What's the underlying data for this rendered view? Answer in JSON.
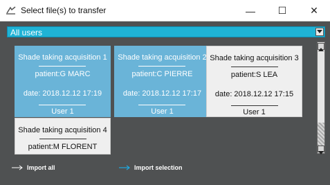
{
  "window": {
    "title": "Select file(s) to transfer",
    "controls": {
      "minimize": "—",
      "maximize": "☐",
      "close": "✕"
    }
  },
  "user_filter": {
    "selected": "All users"
  },
  "acquisitions": [
    {
      "title": "Shade taking acquisition 1",
      "patient": "patient:G MARC",
      "date": "date: 2018.12.12 17:19",
      "user": "User 1",
      "selected": true
    },
    {
      "title": "Shade taking acquisition 2",
      "patient": "patient:C PIERRE",
      "date": "date: 2018.12.12 17:17",
      "user": "User 1",
      "selected": true
    },
    {
      "title": "Shade taking acquisition 3",
      "patient": "patient:S LEA",
      "date": "date: 2018.12.12 17:15",
      "user": "User 1",
      "selected": false
    },
    {
      "title": "Shade taking acquisition 4",
      "patient": "patient:M FLORENT",
      "selected": false
    }
  ],
  "actions": {
    "import_all": "Import all",
    "import_selection": "Import selection"
  },
  "colors": {
    "background": "#4f5152",
    "accent": "#1fb3d6",
    "selected_card": "#6ab4d8",
    "unselected_card": "#efefef",
    "arrow_all": "#ffffff",
    "arrow_selection": "#1fa8e0"
  },
  "icons": {
    "app": "app-icon",
    "dropdown": "chevron-down-icon",
    "import_all": "arrow-right-icon",
    "import_selection": "arrow-right-icon"
  }
}
